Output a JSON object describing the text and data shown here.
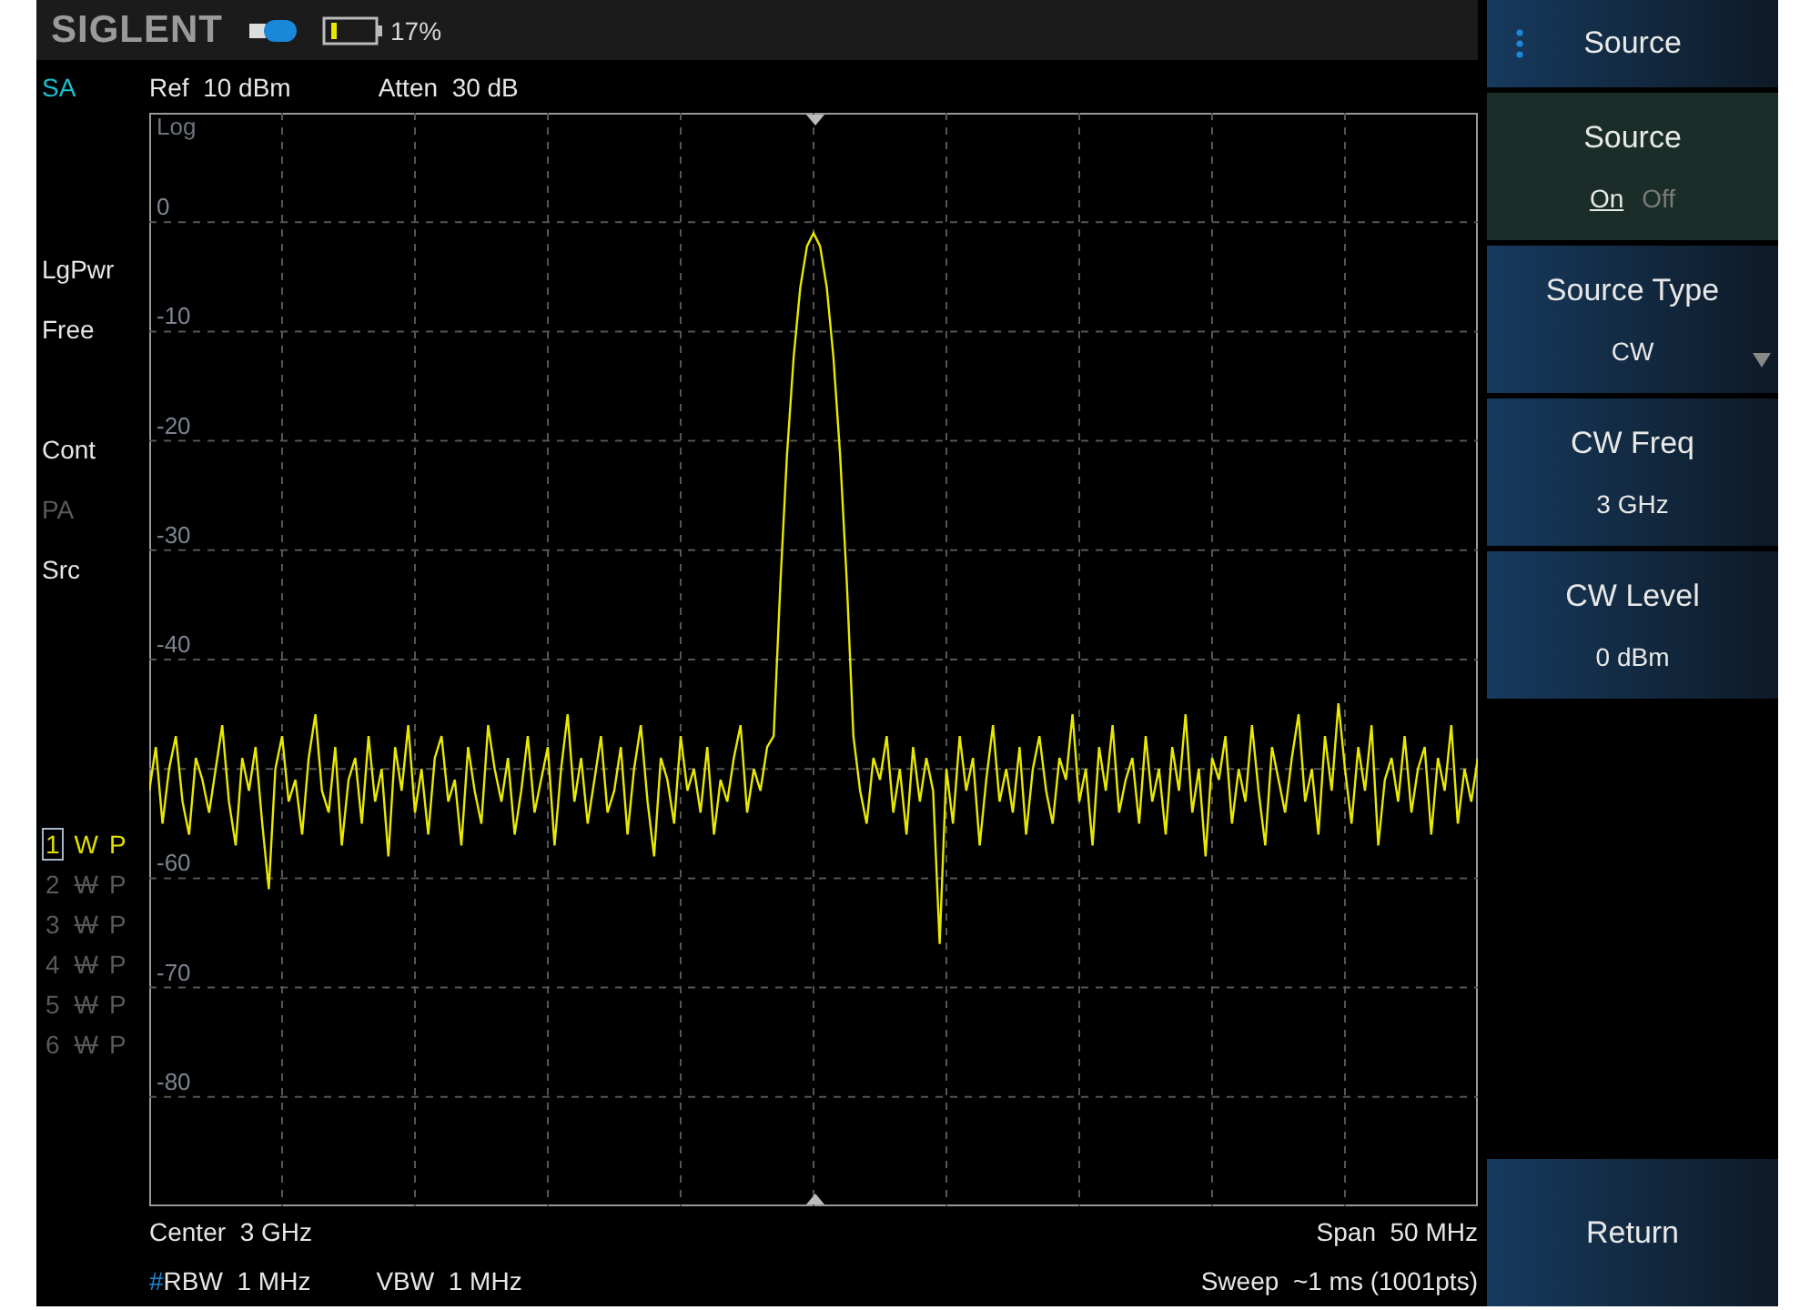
{
  "header": {
    "logo": "SIGLENT",
    "battery_text": "17%"
  },
  "info": {
    "mode": "SA",
    "ref": {
      "label": "Ref",
      "value": "10 dBm"
    },
    "atten": {
      "label": "Atten",
      "value": "30 dB"
    }
  },
  "status": [
    {
      "text": "LgPwr",
      "disabled": false
    },
    {
      "text": "Free",
      "disabled": false
    },
    {
      "text": "Cont",
      "disabled": false
    },
    {
      "text": "PA",
      "disabled": true
    },
    {
      "text": "Src",
      "disabled": false
    }
  ],
  "traces": [
    {
      "number": "1",
      "mode": "W",
      "detector": "P",
      "active": true
    },
    {
      "number": "2",
      "mode": "W",
      "detector": "P",
      "active": false
    },
    {
      "number": "3",
      "mode": "W",
      "detector": "P",
      "active": false
    },
    {
      "number": "4",
      "mode": "W",
      "detector": "P",
      "active": false
    },
    {
      "number": "5",
      "mode": "W",
      "detector": "P",
      "active": false
    },
    {
      "number": "6",
      "mode": "W",
      "detector": "P",
      "active": false
    }
  ],
  "graph": {
    "scale": "Log",
    "chart_data": {
      "type": "line",
      "grid": true,
      "ylim": [
        -90,
        10
      ],
      "yticks": [
        0,
        -10,
        -20,
        -30,
        -40,
        -60,
        -70,
        -80
      ],
      "series": [
        {
          "color": "#e8e800",
          "values": [
            -52,
            -48,
            -55,
            -50,
            -47,
            -53,
            -56,
            -49,
            -51,
            -54,
            -50,
            -46,
            -53,
            -57,
            -49,
            -52,
            -48,
            -55,
            -61,
            -50,
            -47,
            -53,
            -51,
            -56,
            -49,
            -45,
            -52,
            -54,
            -48,
            -57,
            -51,
            -49,
            -55,
            -47,
            -53,
            -50,
            -58,
            -48,
            -52,
            -46,
            -54,
            -50,
            -56,
            -49,
            -47,
            -53,
            -51,
            -57,
            -48,
            -52,
            -55,
            -46,
            -50,
            -53,
            -49,
            -56,
            -52,
            -47,
            -54,
            -51,
            -48,
            -57,
            -50,
            -45,
            -53,
            -49,
            -55,
            -51,
            -47,
            -54,
            -52,
            -48,
            -56,
            -50,
            -46,
            -53,
            -58,
            -49,
            -51,
            -55,
            -47,
            -52,
            -50,
            -54,
            -48,
            -56,
            -51,
            -53,
            -49,
            -46,
            -54,
            -50,
            -52,
            -48,
            -47,
            -33,
            -21.3,
            -12.3,
            -6,
            -2.2,
            -1,
            -2.2,
            -6,
            -12.3,
            -21.3,
            -33,
            -47,
            -52,
            -55,
            -49,
            -51,
            -47,
            -54,
            -50,
            -56,
            -48,
            -53,
            -49,
            -52,
            -66,
            -50,
            -55,
            -47,
            -52,
            -49,
            -57,
            -51,
            -46,
            -53,
            -50,
            -54,
            -48,
            -56,
            -50,
            -47,
            -52,
            -55,
            -49,
            -51,
            -45,
            -53,
            -50,
            -57,
            -48,
            -52,
            -46,
            -54,
            -51,
            -49,
            -55,
            -47,
            -53,
            -50,
            -56,
            -48,
            -52,
            -45,
            -54,
            -50,
            -58,
            -49,
            -51,
            -47,
            -55,
            -50,
            -53,
            -46,
            -52,
            -57,
            -48,
            -51,
            -54,
            -49,
            -45,
            -53,
            -50,
            -56,
            -47,
            -52,
            -44,
            -50,
            -55,
            -48,
            -52,
            -46,
            -57,
            -51,
            -49,
            -53,
            -47,
            -54,
            -50,
            -48,
            -56,
            -49,
            -52,
            -46,
            -55,
            -50,
            -53,
            -49
          ]
        }
      ]
    }
  },
  "footer": {
    "center": {
      "label": "Center",
      "value": "3 GHz"
    },
    "span": {
      "label": "Span",
      "value": "50 MHz"
    },
    "rbw": {
      "flag": "#",
      "label": "RBW",
      "value": "1 MHz"
    },
    "vbw": {
      "label": "VBW",
      "value": "1 MHz"
    },
    "sweep": {
      "label": "Sweep",
      "value": "~1 ms (1001pts)"
    }
  },
  "menu": {
    "title": "Source",
    "items": [
      {
        "kind": "toggle",
        "label": "Source",
        "selected": true,
        "options": [
          {
            "text": "On",
            "selected": true
          },
          {
            "text": "Off",
            "selected": false
          }
        ]
      },
      {
        "kind": "dropdown",
        "label": "Source Type",
        "value": "CW",
        "selected": false
      },
      {
        "kind": "value",
        "label": "CW Freq",
        "value": "3 GHz",
        "selected": false
      },
      {
        "kind": "value",
        "label": "CW Level",
        "value": "0 dBm",
        "selected": false
      }
    ],
    "return": "Return"
  }
}
